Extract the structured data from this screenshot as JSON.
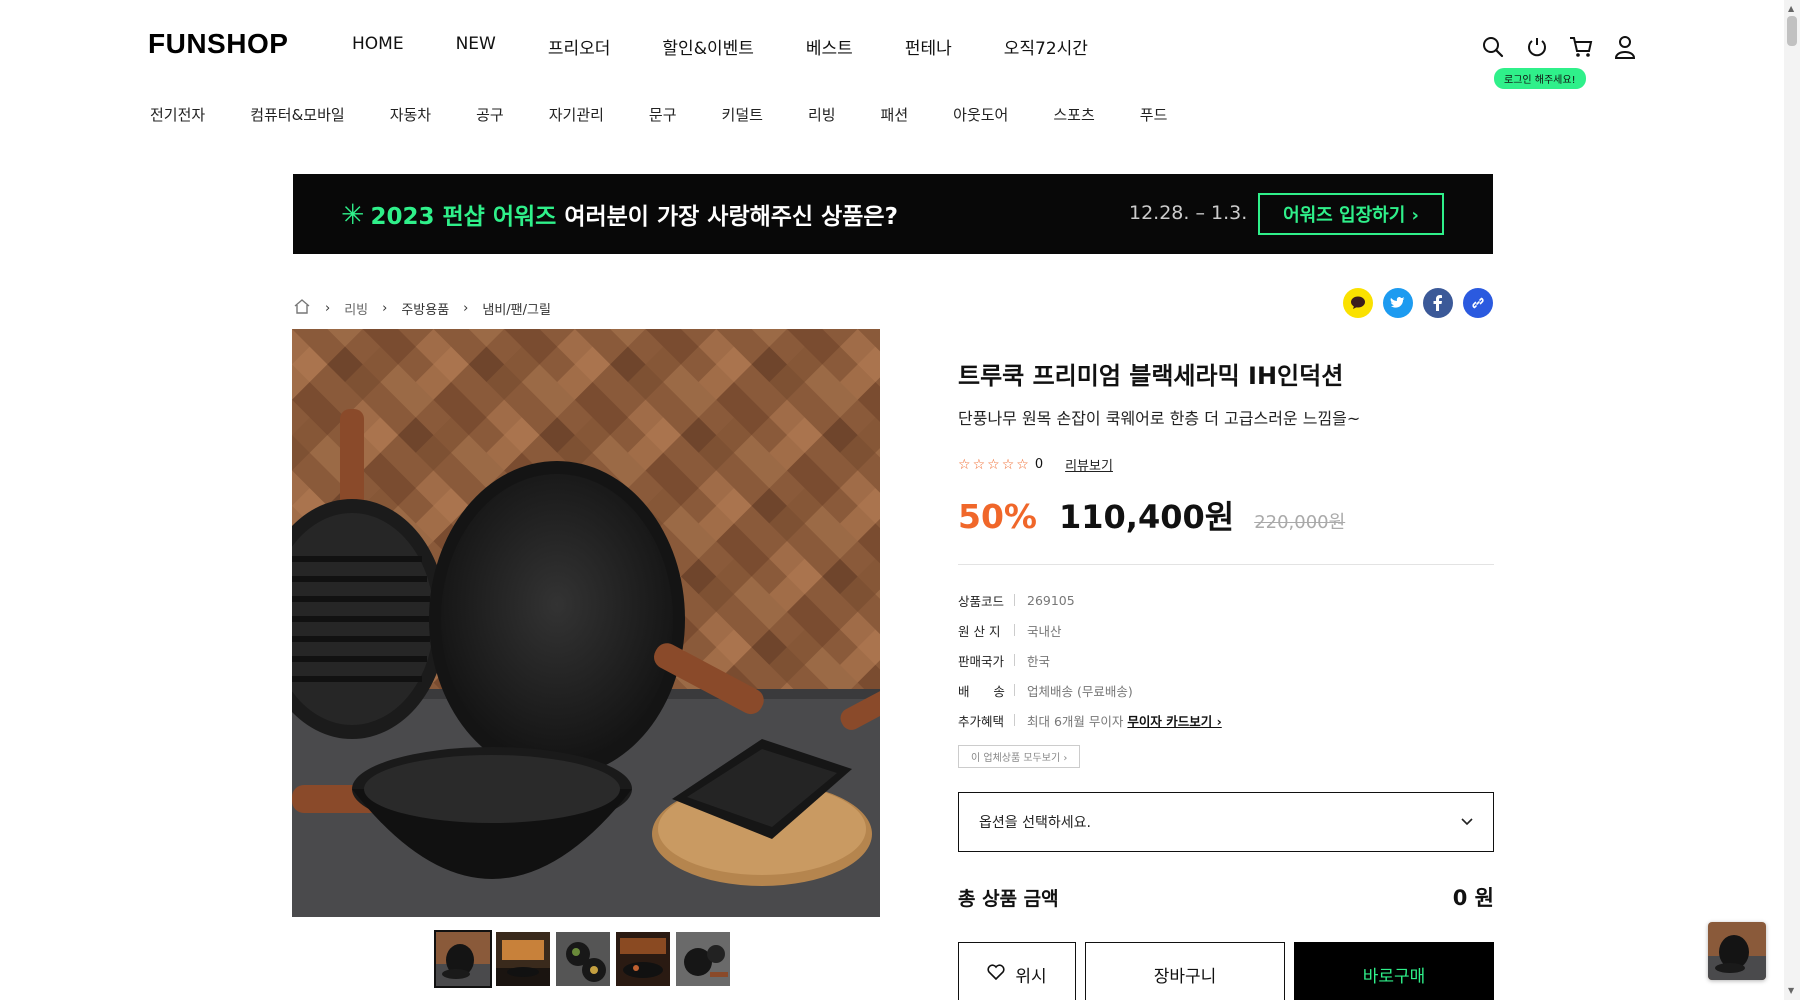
{
  "header": {
    "logo": "FUNSHOP",
    "gnb": [
      "HOME",
      "NEW",
      "프리오더",
      "할인&이벤트",
      "베스트",
      "펀테나",
      "오직72시간"
    ],
    "login_hint": "로그인 해주세요!",
    "icons": [
      "search-icon",
      "power-icon",
      "cart-icon",
      "user-icon"
    ]
  },
  "categories": [
    "전기전자",
    "컴퓨터&모바일",
    "자동차",
    "공구",
    "자기관리",
    "문구",
    "키덜트",
    "리빙",
    "패션",
    "아웃도어",
    "스포츠",
    "푸드"
  ],
  "banner": {
    "star": "✳",
    "highlight": "2023 펀샵 어워즈",
    "text": "여러분이 가장 사랑해주신 상품은?",
    "date": "12.28. – 1.3.",
    "button": "어워즈 입장하기 ›"
  },
  "breadcrumb": [
    "리빙",
    "주방용품",
    "냄비/팬/그릴"
  ],
  "product": {
    "title": "트루쿡 프리미엄 블랙세라믹 IH인덕션",
    "subtitle": "단풍나무 원목 손잡이 쿡웨어로 한층 더 고급스러운 느낌을~",
    "rating_count": "0",
    "review_link": "리뷰보기",
    "discount": "50%",
    "price": "110,400원",
    "original_price": "220,000원",
    "specs": [
      {
        "key": "상품코드",
        "value": "269105"
      },
      {
        "key": "원 산 지",
        "value": "국내산"
      },
      {
        "key": "판매국가",
        "value": "한국"
      },
      {
        "key": "배      송",
        "value": "업체배송 (무료배송)"
      },
      {
        "key": "추가혜택",
        "value": "최대 6개월 무이자",
        "link": "무이자 카드보기 ›"
      }
    ],
    "vendor_button": "이 업체상품 모두보기 ›",
    "option_placeholder": "옵션을 선택하세요.",
    "total_label": "총 상품 금액",
    "total_value": "0 원",
    "wish": "위시",
    "cart": "장바구니",
    "buy": "바로구매"
  },
  "colors": {
    "accent_green": "#2ff08a",
    "discount_orange": "#f0672a",
    "banner_bg": "#080808"
  }
}
